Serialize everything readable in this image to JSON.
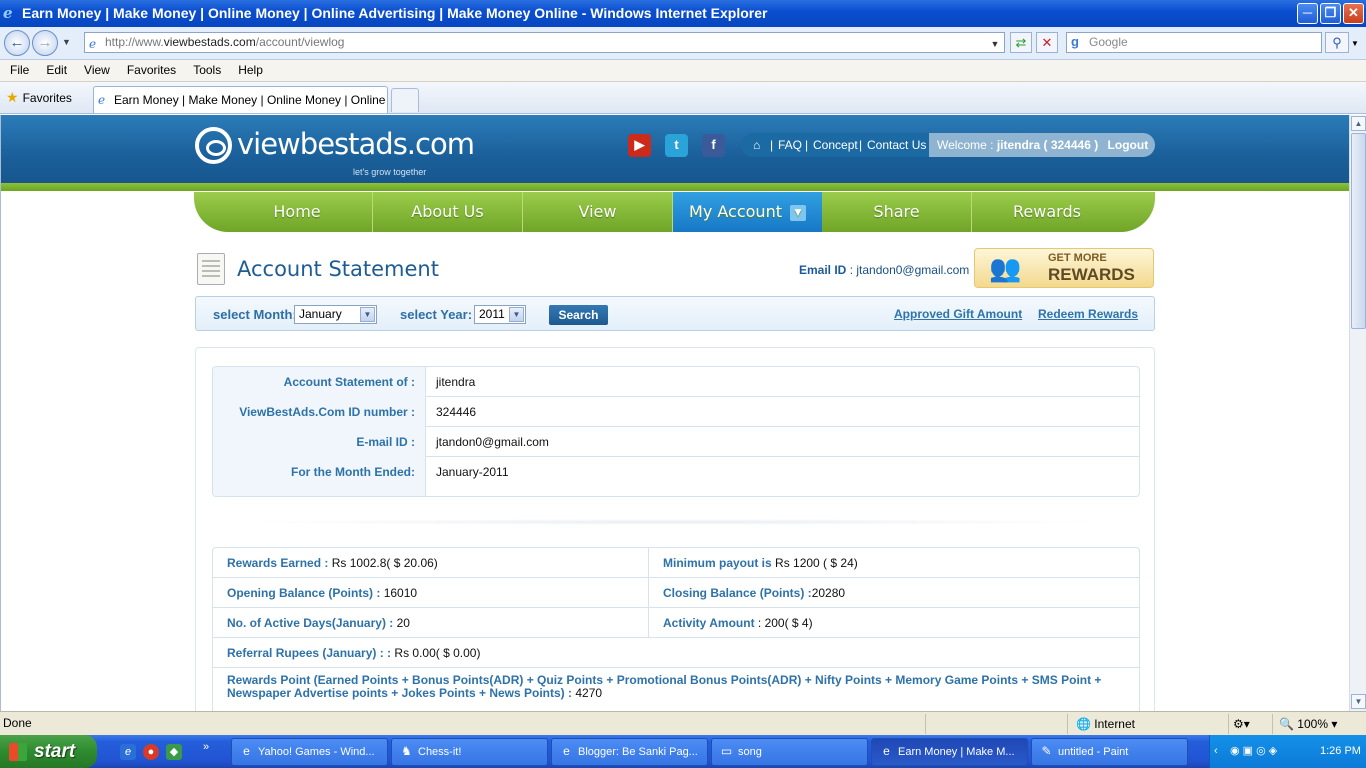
{
  "window": {
    "title": "Earn Money | Make Money | Online Money | Online Advertising | Make Money Online - Windows Internet Explorer",
    "minimize": "─",
    "maximize": "❐",
    "close": "✕"
  },
  "address_bar": {
    "url_prefix": "http://www.",
    "url_domain": "viewbestads.com",
    "url_path": "/account/viewlog",
    "search_placeholder": "Google"
  },
  "menu": [
    "File",
    "Edit",
    "View",
    "Favorites",
    "Tools",
    "Help"
  ],
  "favorites_label": "Favorites",
  "tab": {
    "title": "Earn Money | Make Money | Online Money | Online Ad..."
  },
  "site": {
    "logo_name": "viewbestads.com",
    "logo_tagline": "let's grow together",
    "social": [
      {
        "name": "youtube",
        "glyph": "▶",
        "color": "#cc2a1a"
      },
      {
        "name": "twitter",
        "glyph": "t",
        "color": "#2aa3d8"
      },
      {
        "name": "facebook",
        "glyph": "f",
        "color": "#3b5a99"
      }
    ],
    "top_links": {
      "home_glyph": "⌂",
      "faq": "FAQ",
      "concept": "Concept",
      "contact": "Contact Us",
      "welcome_prefix": "Welcome :",
      "welcome_user": "jitendra ( 324446 )",
      "logout": "Logout"
    },
    "nav": [
      "Home",
      "About Us",
      "View",
      "My Account",
      "Share",
      "Rewards"
    ],
    "nav_active": "My Account"
  },
  "page": {
    "title": "Account Statement",
    "email_label": "Email ID",
    "email_value": ": jtandon0@gmail.com",
    "banner_line1": "GET MORE",
    "banner_line2": "REWARDS"
  },
  "filter": {
    "month_label": "select Month:",
    "month_value": "January",
    "year_label": "select Year:",
    "year_value": "2011",
    "search_button": "Search",
    "approved_link": "Approved Gift Amount",
    "redeem_link": "Redeem Rewards"
  },
  "info_rows": [
    {
      "label": "Account Statement of :",
      "value": "jitendra"
    },
    {
      "label": "ViewBestAds.Com ID number :",
      "value": "324446"
    },
    {
      "label": "E-mail ID :",
      "value": "jtandon0@gmail.com"
    },
    {
      "label": "For the Month Ended:",
      "value": "January-2011"
    }
  ],
  "summary": {
    "rewards_earned_label": "Rewards Earned :",
    "rewards_earned_value": "Rs 1002.8( $ 20.06)",
    "min_payout_label": "Minimum payout is",
    "min_payout_value": "Rs 1200 ( $ 24)",
    "opening_label": "Opening Balance (Points) :",
    "opening_value": "16010",
    "closing_label": "Closing Balance (Points) :",
    "closing_value": "20280",
    "active_days_label": "No. of Active Days(January) :",
    "active_days_value": "20",
    "activity_label": "Activity Amount",
    "activity_value": ": 200( $ 4)",
    "referral_label": "Referral Rupees (January) : :",
    "referral_value": "Rs 0.00( $ 0.00)",
    "points_label": "Rewards Point (Earned Points + Bonus Points(ADR) + Quiz Points + Promotional Bonus Points(ADR) + Nifty Points + Memory Game Points + SMS Point + Newspaper Advertise points + Jokes Points + News Points) :",
    "points_value": "4270"
  },
  "status": {
    "text": "Done",
    "zone": "Internet",
    "zoom": "100%"
  },
  "taskbar": {
    "start": "start",
    "tasks": [
      {
        "label": "Yahoo! Games - Wind...",
        "icon": "e"
      },
      {
        "label": "Chess-it!",
        "icon": "♞"
      },
      {
        "label": "Blogger: Be Sanki Pag...",
        "icon": "e"
      },
      {
        "label": "song",
        "icon": "▭"
      },
      {
        "label": "Earn Money | Make M...",
        "icon": "e"
      },
      {
        "label": "untitled - Paint",
        "icon": "✎"
      }
    ],
    "clock": "1:26 PM"
  }
}
